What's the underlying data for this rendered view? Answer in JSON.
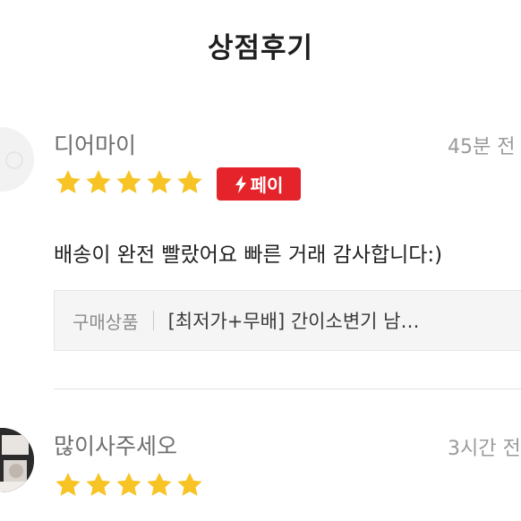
{
  "header": {
    "title": "상점후기"
  },
  "reviews": [
    {
      "username": "디어마이",
      "time": "45분 전",
      "rating": 5,
      "pay_badge": "페이",
      "text": "배송이 완전 빨랐어요 빠른 거래 감사합니다:)",
      "product_label": "구매상품",
      "product_name": "[최저가+무배] 간이소변기 남…"
    },
    {
      "username": "많이사주세오",
      "time": "3시간 전",
      "rating": 5
    }
  ],
  "colors": {
    "star": "#f7c325",
    "pay_badge": "#e5232b",
    "username": "#6f6f6f",
    "time": "#9a9a9a"
  }
}
